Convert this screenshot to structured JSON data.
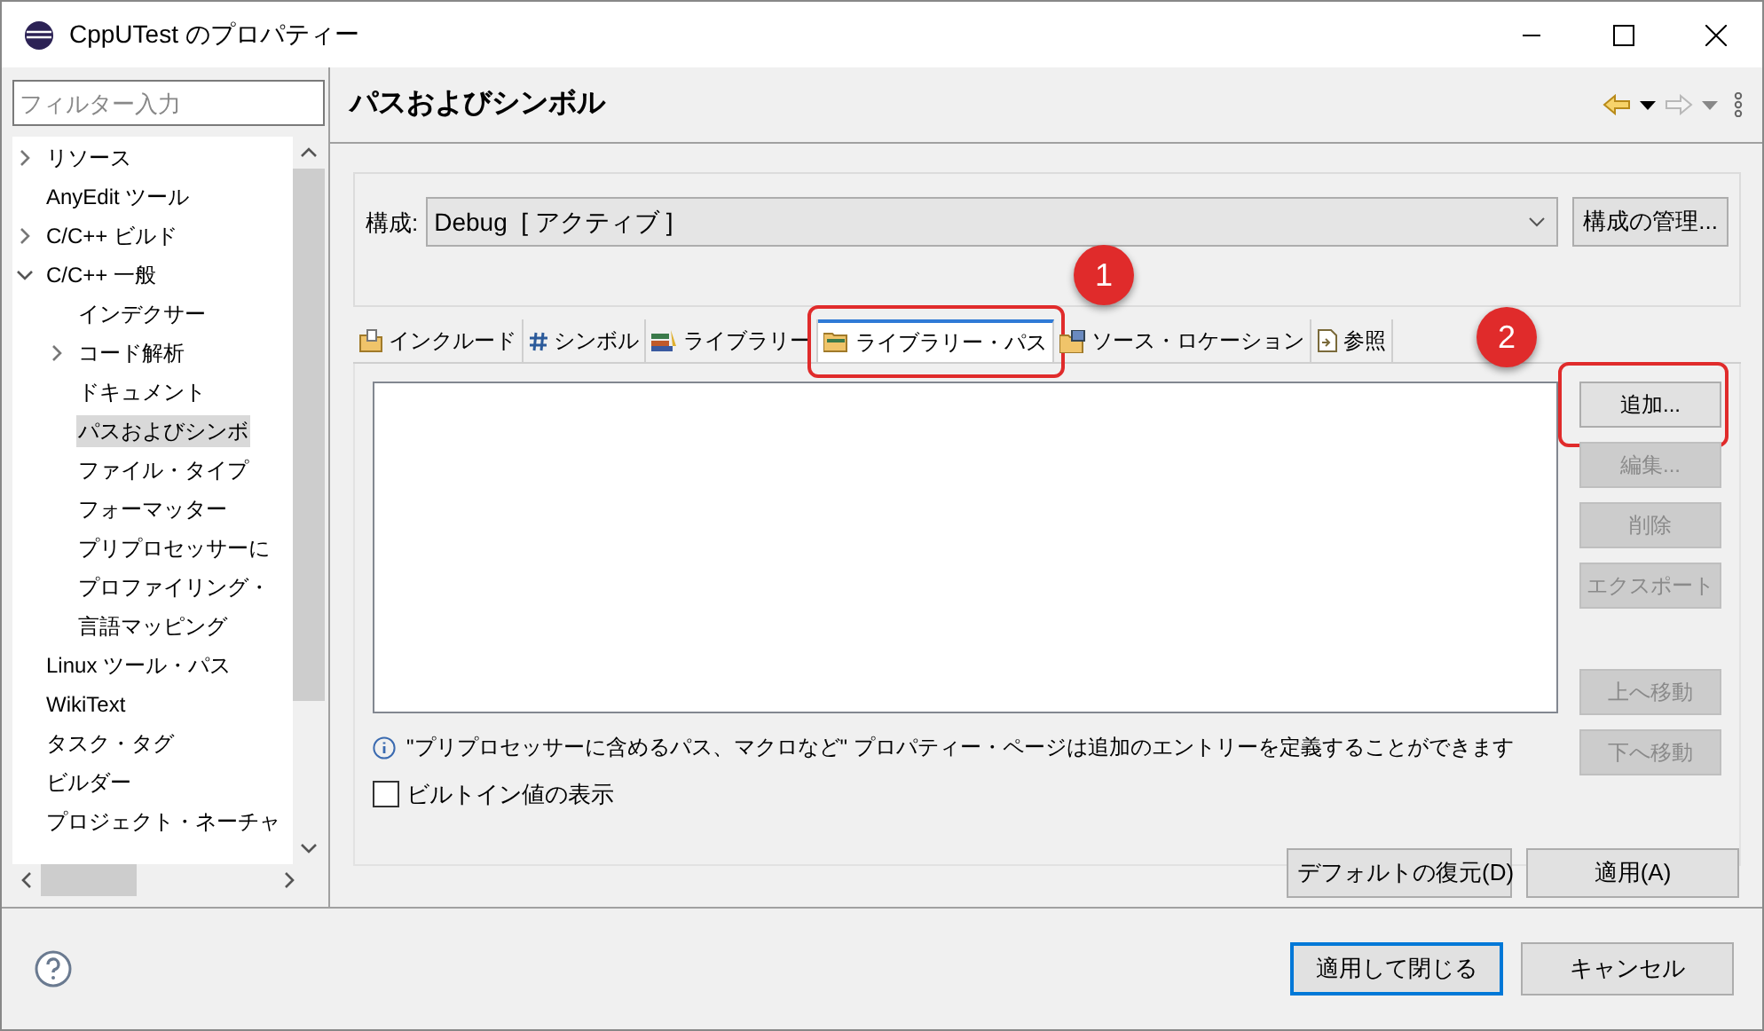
{
  "window": {
    "title": "CppUTest のプロパティー"
  },
  "filter": {
    "placeholder": "フィルター入力"
  },
  "tree": [
    {
      "label": "リソース",
      "expanded": false,
      "selected": false
    },
    {
      "label": "AnyEdit ツール",
      "selected": false
    },
    {
      "label": "C/C++ ビルド",
      "expanded": false,
      "selected": false
    },
    {
      "label": "C/C++ 一般",
      "expanded": true,
      "selected": false,
      "children": [
        {
          "label": "インデクサー",
          "selected": false
        },
        {
          "label": "コード解析",
          "expanded": false,
          "selected": false
        },
        {
          "label": "ドキュメント",
          "selected": false
        },
        {
          "label": "パスおよびシンボ",
          "selected": true
        },
        {
          "label": "ファイル・タイプ",
          "selected": false
        },
        {
          "label": "フォーマッター",
          "selected": false
        },
        {
          "label": "プリプロセッサーに",
          "selected": false
        },
        {
          "label": "プロファイリング・",
          "selected": false
        },
        {
          "label": "言語マッピング",
          "selected": false
        }
      ]
    },
    {
      "label": "Linux ツール・パス",
      "selected": false
    },
    {
      "label": "WikiText",
      "selected": false
    },
    {
      "label": "タスク・タグ",
      "selected": false
    },
    {
      "label": "ビルダー",
      "selected": false
    },
    {
      "label": "プロジェクト・ネーチャ",
      "selected": false
    }
  ],
  "page": {
    "title": "パスおよびシンボル",
    "forward_disabled": true
  },
  "configuration": {
    "label": "構成:",
    "value": "Debug  [ アクティブ ]",
    "manage_button": "構成の管理..."
  },
  "tabs": [
    {
      "label": "インクルード",
      "kind": "include",
      "selected": false
    },
    {
      "label": "シンボル",
      "kind": "symbol",
      "selected": false
    },
    {
      "label": "ライブラリー",
      "kind": "library",
      "selected": false
    },
    {
      "label": "ライブラリー・パス",
      "kind": "libpath",
      "selected": true
    },
    {
      "label": "ソース・ロケーション",
      "kind": "source",
      "selected": false
    },
    {
      "label": "参照",
      "kind": "reference",
      "selected": false
    }
  ],
  "side_buttons": [
    {
      "label": "追加...",
      "disabled": false
    },
    {
      "label": "編集...",
      "disabled": true
    },
    {
      "label": "削除",
      "disabled": true
    },
    {
      "label": "エクスポート",
      "disabled": true
    }
  ],
  "move_buttons": [
    {
      "label": "上へ移動",
      "disabled": true
    },
    {
      "label": "下へ移動",
      "disabled": true
    }
  ],
  "info": "\"プリプロセッサーに含めるパス、マクロなど\" プロパティー・ページは追加のエントリーを定義することができます",
  "builtin_checkbox": {
    "label": "ビルトイン値の表示",
    "checked": false
  },
  "page_buttons": [
    "デフォルトの復元(D)",
    "適用(A)"
  ],
  "dialog_buttons": [
    {
      "label": "適用して閉じる",
      "default": true
    },
    {
      "label": "キャンセル",
      "default": false
    }
  ],
  "callouts": [
    "1",
    "2"
  ]
}
